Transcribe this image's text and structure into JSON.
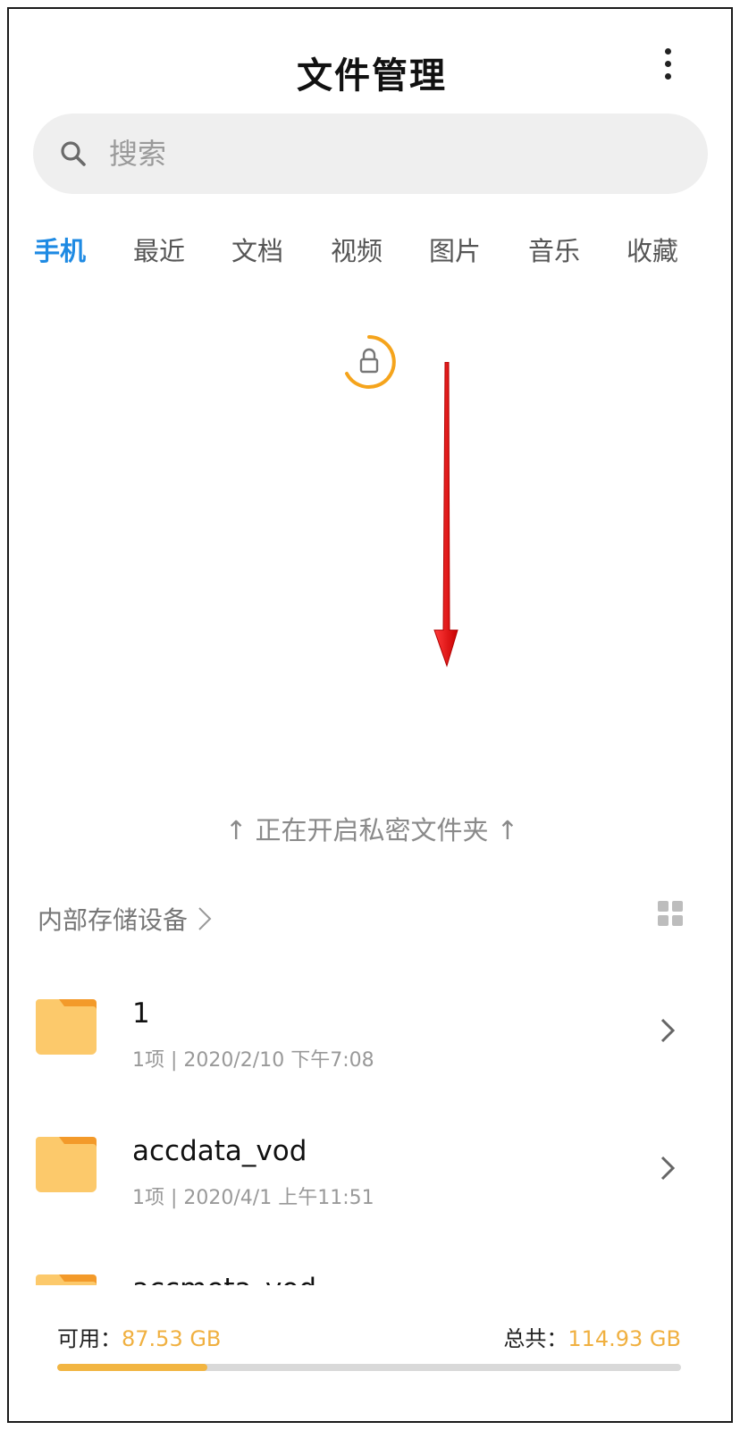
{
  "header": {
    "title": "文件管理"
  },
  "search": {
    "placeholder": "搜索"
  },
  "tabs": [
    {
      "label": "手机",
      "active": true
    },
    {
      "label": "最近",
      "active": false
    },
    {
      "label": "文档",
      "active": false
    },
    {
      "label": "视频",
      "active": false
    },
    {
      "label": "图片",
      "active": false
    },
    {
      "label": "音乐",
      "active": false
    },
    {
      "label": "收藏",
      "active": false
    }
  ],
  "private_folder": {
    "hint": "↑ 正在开启私密文件夹 ↑"
  },
  "storage": {
    "path_label": "内部存储设备"
  },
  "files": [
    {
      "name": "1",
      "meta": "1项 | 2020/2/10 下午7:08"
    },
    {
      "name": "accdata_vod",
      "meta": "1项 | 2020/4/1 上午11:51"
    },
    {
      "name": "accmeta_vod",
      "meta": ""
    }
  ],
  "footer": {
    "available_label": "可用：",
    "available_value": "87.53 GB",
    "total_label": "总共：",
    "total_value": "114.93 GB",
    "used_fraction": 0.24
  },
  "colors": {
    "accent": "#1e8ae3",
    "folder": "#fcc96b",
    "folder_tab": "#f39a2a",
    "storage_fill": "#f2b542",
    "arrow": "#e8141b",
    "lock_ring": "#f5a41c"
  }
}
